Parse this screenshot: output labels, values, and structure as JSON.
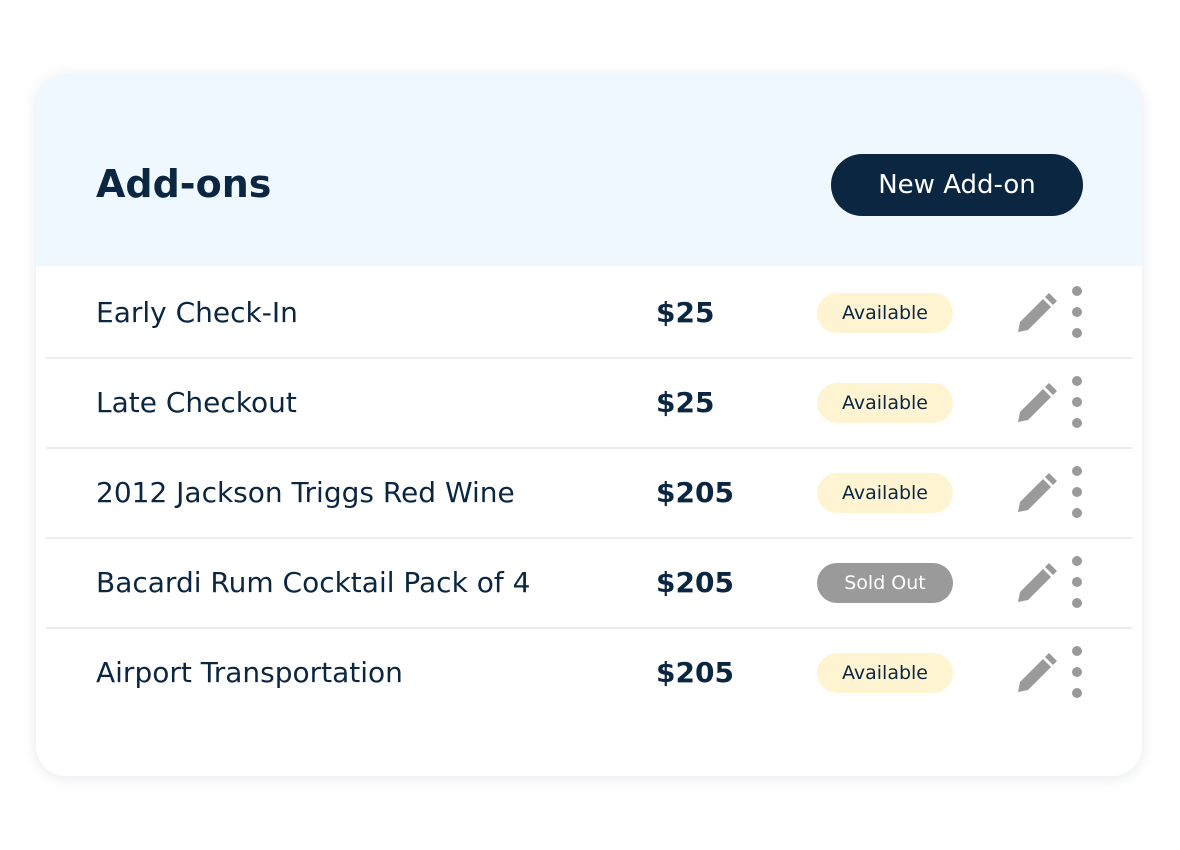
{
  "header": {
    "title": "Add-ons",
    "new_button_label": "New Add-on"
  },
  "colors": {
    "header_bg": "#eff8fe",
    "primary_navy": "#0b2640",
    "available_badge_bg": "#fef4d2",
    "sold_out_badge_bg": "#9a9a9a",
    "icon_gray": "#9a9a9a"
  },
  "addons": [
    {
      "name": "Early Check-In",
      "price": "$25",
      "status": "Available",
      "status_type": "available",
      "edit_icon": "pencil-icon",
      "menu_icon": "vertical-ellipsis-icon"
    },
    {
      "name": "Late Checkout",
      "price": "$25",
      "status": "Available",
      "status_type": "available",
      "edit_icon": "pencil-icon",
      "menu_icon": "vertical-ellipsis-icon"
    },
    {
      "name": "2012 Jackson Triggs Red Wine",
      "price": "$205",
      "status": "Available",
      "status_type": "available",
      "edit_icon": "pencil-icon",
      "menu_icon": "vertical-ellipsis-icon"
    },
    {
      "name": "Bacardi Rum Cocktail Pack of 4",
      "price": "$205",
      "status": "Sold Out",
      "status_type": "sold",
      "edit_icon": "pencil-icon",
      "menu_icon": "vertical-ellipsis-icon"
    },
    {
      "name": "Airport Transportation",
      "price": "$205",
      "status": "Available",
      "status_type": "available",
      "edit_icon": "pencil-icon",
      "menu_icon": "vertical-ellipsis-icon"
    }
  ]
}
